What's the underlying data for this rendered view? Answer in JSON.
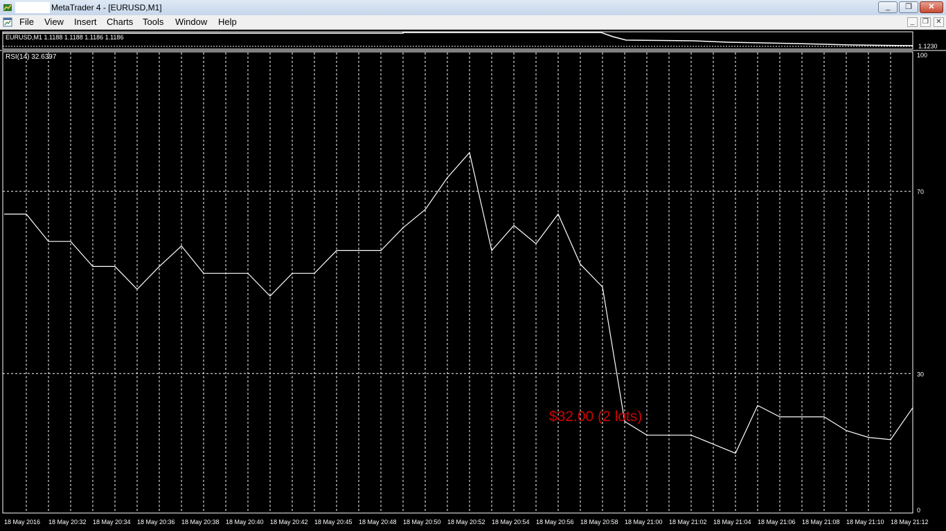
{
  "window": {
    "title": "MetaTrader 4 - [EURUSD,M1]",
    "controls": [
      "_",
      "❐",
      "✕"
    ]
  },
  "menu": {
    "items": [
      "File",
      "View",
      "Insert",
      "Charts",
      "Tools",
      "Window",
      "Help"
    ],
    "mdi_controls": [
      "_",
      "❐",
      "✕"
    ]
  },
  "price_panel": {
    "label": "EURUSD,M1  1.1188 1.1188 1.1186 1.1186",
    "price_tick": "1.1230"
  },
  "indicator": {
    "label": "RSI(14) 32.6397",
    "levels": [
      "100",
      "70",
      "30",
      "0"
    ]
  },
  "annotation": {
    "text": "$32.00 (2 lots)",
    "color": "#d00000"
  },
  "chart_data": {
    "type": "line",
    "series": [
      {
        "name": "RSI(14)",
        "values": [
          65,
          65,
          59,
          59,
          53.5,
          53.5,
          48.5,
          53.5,
          58,
          52,
          52,
          52,
          47,
          52,
          52,
          57,
          57,
          57,
          62,
          66,
          73,
          78.5,
          57,
          62.5,
          58.5,
          65,
          54,
          49,
          19.5,
          16.5,
          16.5,
          16.5,
          14.5,
          12.5,
          23,
          20.5,
          20.5,
          20.5,
          17.5,
          16,
          15.5,
          22.5
        ]
      }
    ],
    "x_tick_labels": [
      "18 May 2016",
      "18 May 20:32",
      "18 May 20:34",
      "18 May 20:36",
      "18 May 20:38",
      "18 May 20:40",
      "18 May 20:42",
      "18 May 20:45",
      "18 May 20:48",
      "18 May 20:50",
      "18 May 20:52",
      "18 May 20:54",
      "18 May 20:56",
      "18 May 20:58",
      "18 May 21:00",
      "18 May 21:02",
      "18 May 21:04",
      "18 May 21:06",
      "18 May 21:08",
      "18 May 21:10",
      "18 May 21:12"
    ],
    "ylim": [
      0,
      100
    ],
    "y_levels": [
      100,
      70,
      30,
      0
    ],
    "grid": true,
    "line_color": "#ffffff",
    "background": "#000000"
  }
}
